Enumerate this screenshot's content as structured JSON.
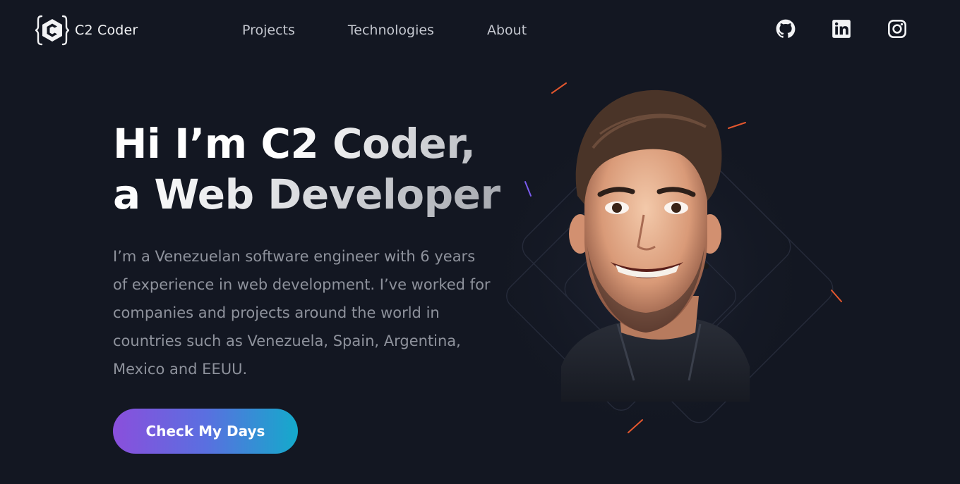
{
  "header": {
    "brand": "C2 Coder",
    "logo_icon": "curly-brace-c-logo",
    "nav": [
      {
        "label": "Projects"
      },
      {
        "label": "Technologies"
      },
      {
        "label": "About"
      }
    ],
    "social": [
      {
        "icon": "github-icon"
      },
      {
        "icon": "linkedin-icon"
      },
      {
        "icon": "instagram-icon"
      }
    ]
  },
  "hero": {
    "title_line1": "Hi I’m C2 Coder,",
    "title_line2": "a Web Developer",
    "description": "I’m a Venezuelan software engineer with 6 years of experience in web development. I’ve worked for companies and projects around the world in countries such as Venezuela, Spain, Argentina, Mexico and EEUU.",
    "cta_label": "Check My Days"
  },
  "colors": {
    "background": "#131722",
    "cta_gradient_start": "#8a4fdc",
    "cta_gradient_end": "#14aacb",
    "body_text": "#8e929c"
  }
}
